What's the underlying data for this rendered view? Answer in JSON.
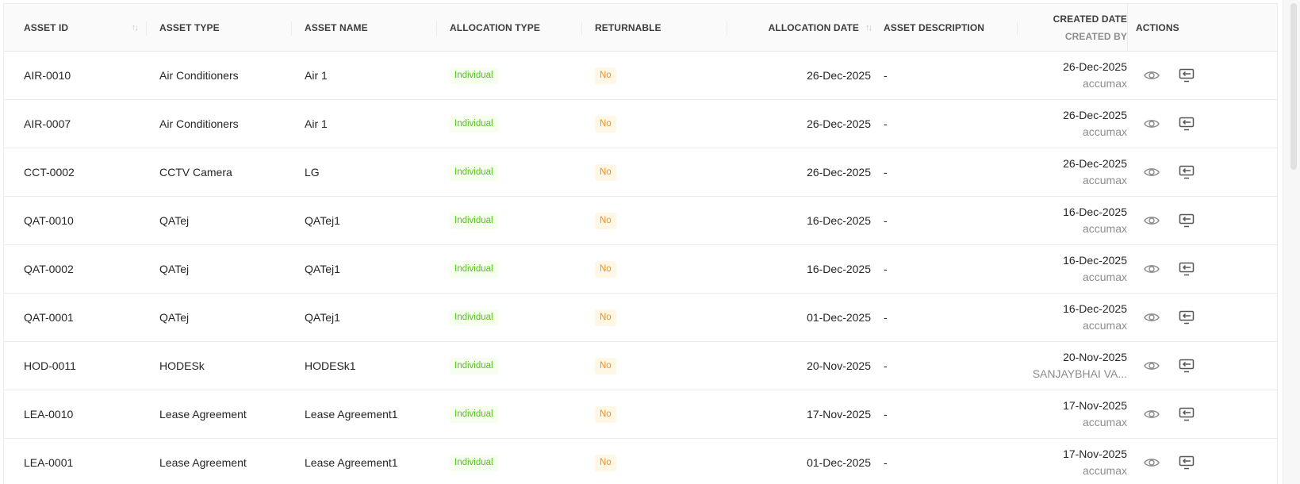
{
  "columns": {
    "asset_id": "ASSET ID",
    "asset_type": "ASSET TYPE",
    "asset_name": "ASSET NAME",
    "allocation_type": "ALLOCATION TYPE",
    "returnable": "RETURNABLE",
    "allocation_date": "ALLOCATION DATE",
    "asset_description": "ASSET DESCRIPTION",
    "created_date": "CREATED DATE",
    "created_by": "CREATED BY",
    "actions": "ACTIONS"
  },
  "icons": {
    "sort": "sort-icon",
    "view": "eye-icon",
    "reallocate": "monitor-arrow-icon"
  },
  "colors": {
    "individual_tag": "#52c41a",
    "individual_tag_bg": "#f6ffed",
    "no_tag": "#fa8c16",
    "no_tag_bg": "#fff7e6"
  },
  "rows": [
    {
      "asset_id": "AIR-0010",
      "asset_type": "Air Conditioners",
      "asset_name": "Air 1",
      "allocation_type": "Individual",
      "returnable": "No",
      "allocation_date": "26-Dec-2025",
      "asset_description": "-",
      "created_date": "26-Dec-2025",
      "created_by": "accumax"
    },
    {
      "asset_id": "AIR-0007",
      "asset_type": "Air Conditioners",
      "asset_name": "Air 1",
      "allocation_type": "Individual",
      "returnable": "No",
      "allocation_date": "26-Dec-2025",
      "asset_description": "-",
      "created_date": "26-Dec-2025",
      "created_by": "accumax"
    },
    {
      "asset_id": "CCT-0002",
      "asset_type": "CCTV Camera",
      "asset_name": "LG",
      "allocation_type": "Individual",
      "returnable": "No",
      "allocation_date": "26-Dec-2025",
      "asset_description": "-",
      "created_date": "26-Dec-2025",
      "created_by": "accumax"
    },
    {
      "asset_id": "QAT-0010",
      "asset_type": "QATej",
      "asset_name": "QATej1",
      "allocation_type": "Individual",
      "returnable": "No",
      "allocation_date": "16-Dec-2025",
      "asset_description": "-",
      "created_date": "16-Dec-2025",
      "created_by": "accumax"
    },
    {
      "asset_id": "QAT-0002",
      "asset_type": "QATej",
      "asset_name": "QATej1",
      "allocation_type": "Individual",
      "returnable": "No",
      "allocation_date": "16-Dec-2025",
      "asset_description": "-",
      "created_date": "16-Dec-2025",
      "created_by": "accumax"
    },
    {
      "asset_id": "QAT-0001",
      "asset_type": "QATej",
      "asset_name": "QATej1",
      "allocation_type": "Individual",
      "returnable": "No",
      "allocation_date": "01-Dec-2025",
      "asset_description": "-",
      "created_date": "16-Dec-2025",
      "created_by": "accumax"
    },
    {
      "asset_id": "HOD-0011",
      "asset_type": "HODESk",
      "asset_name": "HODESk1",
      "allocation_type": "Individual",
      "returnable": "No",
      "allocation_date": "20-Nov-2025",
      "asset_description": "-",
      "created_date": "20-Nov-2025",
      "created_by": "SANJAYBHAI VA..."
    },
    {
      "asset_id": "LEA-0010",
      "asset_type": "Lease Agreement",
      "asset_name": "Lease Agreement1",
      "allocation_type": "Individual",
      "returnable": "No",
      "allocation_date": "17-Nov-2025",
      "asset_description": "-",
      "created_date": "17-Nov-2025",
      "created_by": "accumax"
    },
    {
      "asset_id": "LEA-0001",
      "asset_type": "Lease Agreement",
      "asset_name": "Lease Agreement1",
      "allocation_type": "Individual",
      "returnable": "No",
      "allocation_date": "01-Dec-2025",
      "asset_description": "-",
      "created_date": "17-Nov-2025",
      "created_by": "accumax"
    }
  ]
}
